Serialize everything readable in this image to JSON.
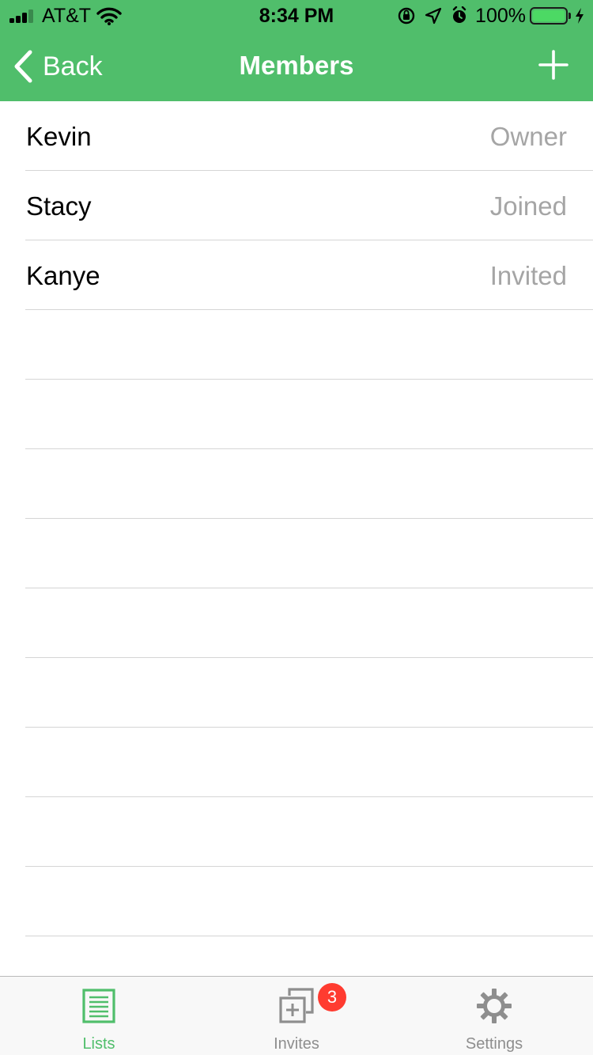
{
  "status_bar": {
    "carrier": "AT&T",
    "time": "8:34 PM",
    "battery_percent": "100%",
    "signal_bars_filled": 3,
    "signal_bars_total": 4,
    "battery_level": 1.0,
    "charging": true
  },
  "nav": {
    "back_label": "Back",
    "title": "Members",
    "add_icon": "plus-icon"
  },
  "members": [
    {
      "name": "Kevin",
      "status": "Owner"
    },
    {
      "name": "Stacy",
      "status": "Joined"
    },
    {
      "name": "Kanye",
      "status": "Invited"
    }
  ],
  "empty_rows": 9,
  "tabs": [
    {
      "label": "Lists",
      "icon": "list-icon",
      "active": true
    },
    {
      "label": "Invites",
      "icon": "invites-icon",
      "badge": "3",
      "active": false
    },
    {
      "label": "Settings",
      "icon": "gear-icon",
      "active": false
    }
  ],
  "colors": {
    "brand_green": "#50be6b",
    "inactive_tab": "#8e8e8e",
    "status_text": "#a5a5a5",
    "badge_red": "#ff3b30",
    "battery_green": "#4cd964"
  }
}
